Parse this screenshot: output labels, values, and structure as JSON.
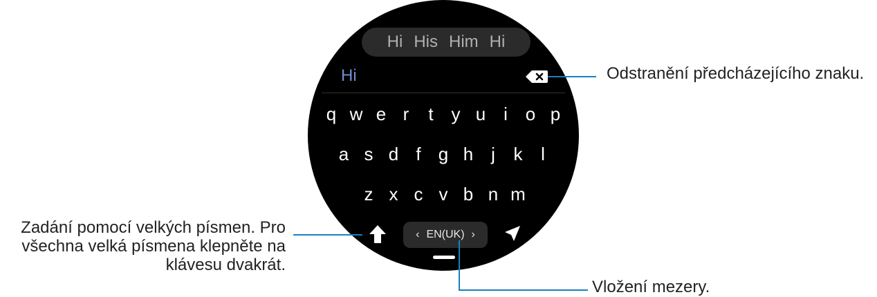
{
  "keyboard": {
    "suggestions": [
      "Hi",
      "His",
      "Him",
      "Hi"
    ],
    "typed_text": "Hi",
    "rows": [
      [
        "q",
        "w",
        "e",
        "r",
        "t",
        "y",
        "u",
        "i",
        "o",
        "p"
      ],
      [
        "a",
        "s",
        "d",
        "f",
        "g",
        "h",
        "j",
        "k",
        "l"
      ],
      [
        "z",
        "x",
        "c",
        "v",
        "b",
        "n",
        "m"
      ]
    ],
    "language": {
      "prev_glyph": "‹",
      "label": "EN(UK)",
      "next_glyph": "›"
    },
    "icons": {
      "backspace": "backspace-icon",
      "shift": "shift-arrow-icon",
      "send": "send-icon"
    }
  },
  "callouts": {
    "delete": "Odstranění předcházejícího znaku.",
    "caps_line1": "Zadání pomocí velkých písmen. Pro",
    "caps_line2": "všechna velká písmena klepněte na",
    "caps_line3": "klávesu dvakrát.",
    "space": "Vložení mezery."
  },
  "colors": {
    "accent_line": "#1a7fc1",
    "typed_text": "#6f8fd0",
    "watch_background": "#000000"
  }
}
